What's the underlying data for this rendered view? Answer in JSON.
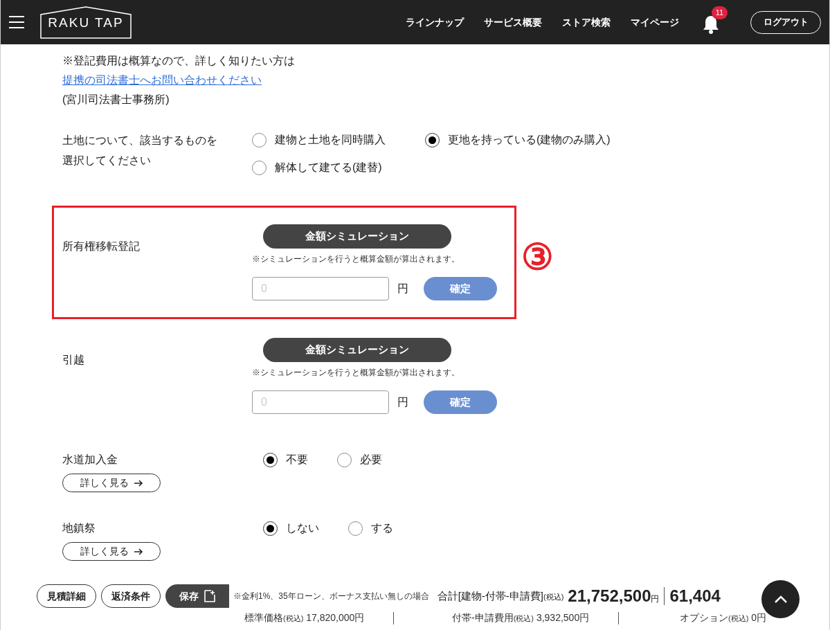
{
  "header": {
    "logo": "RAKU TAP",
    "nav": [
      "ラインナップ",
      "サービス概要",
      "ストア検索",
      "マイページ"
    ],
    "notification_count": "11",
    "logout": "ログアウト"
  },
  "notice": {
    "text": "※登記費用は概算なので、詳しく知りたい方は",
    "link": "提携の司法書士へお問い合わせください",
    "office": "(宮川司法書士事務所)"
  },
  "land": {
    "label": "土地について、該当するものを選択してください",
    "options": [
      {
        "label": "建物と土地を同時購入",
        "selected": false
      },
      {
        "label": "更地を持っている(建物のみ購入)",
        "selected": true
      },
      {
        "label": "解体して建てる(建替)",
        "selected": false
      }
    ]
  },
  "sections": [
    {
      "kind": "simulation",
      "label": "所有権移転登記",
      "highlighted": true,
      "annotation": "③",
      "button": "金額シミュレーション",
      "note": "※シミュレーションを行うと概算金額が算出されます。",
      "placeholder": "0",
      "unit": "円",
      "confirm": "確定"
    },
    {
      "kind": "simulation",
      "label": "引越",
      "highlighted": false,
      "button": "金額シミュレーション",
      "note": "※シミュレーションを行うと概算金額が算出されます。",
      "placeholder": "0",
      "unit": "円",
      "confirm": "確定"
    },
    {
      "kind": "radio",
      "label": "水道加入金",
      "details": "詳しく見る",
      "options": [
        {
          "label": "不要",
          "selected": true
        },
        {
          "label": "必要",
          "selected": false
        }
      ]
    },
    {
      "kind": "radio",
      "label": "地鎮祭",
      "details": "詳しく見る",
      "options": [
        {
          "label": "しない",
          "selected": true
        },
        {
          "label": "する",
          "selected": false
        }
      ]
    }
  ],
  "footer": {
    "buttons": [
      "見積詳細",
      "返済条件"
    ],
    "save": "保存",
    "loan_note": "※金利1%、35年ローン、ボーナス支払い無しの場合",
    "total_label": "合計[建物-付帯-申請費]",
    "tax": "(税込)",
    "total": "21,752,500",
    "yen": "円",
    "monthly": "61,404",
    "breakdown": [
      {
        "label": "標準価格",
        "tax": "(税込)",
        "value": "17,820,000円"
      },
      {
        "label": "付帯-申請費用",
        "tax": "(税込)",
        "value": "3,932,500円"
      },
      {
        "label": "オプション",
        "tax": "(税込)",
        "value": "0円"
      }
    ]
  }
}
